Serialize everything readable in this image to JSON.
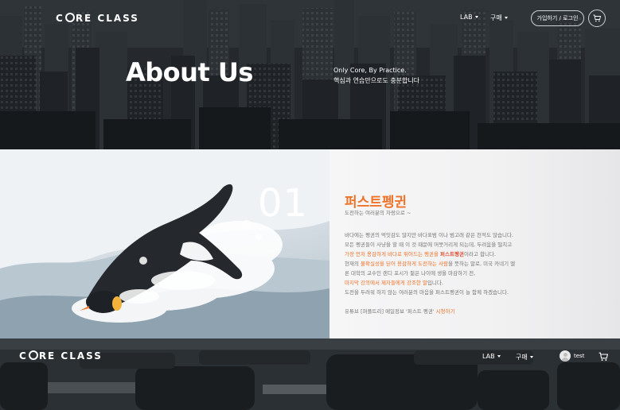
{
  "brand": {
    "logo_text_left": "C",
    "logo_text_right": "RE CLASS"
  },
  "nav": {
    "lab_label": "LAB",
    "buy_label": "구매",
    "auth_label": "가입하기 / 로그인",
    "user_label": "test"
  },
  "hero": {
    "title": "About Us",
    "subtitle_line1": "Only Core, By Practice.",
    "subtitle_line2": "핵심과 연습만으로도 충분합니다"
  },
  "feature": {
    "number": "01",
    "title": "퍼스트펭귄",
    "subtitle": "도전하는 여러분의 자랑으로 ~",
    "lines": [
      {
        "parts": [
          {
            "t": "바다에는 펭귄의 먹잇감도 많지만 바다표범 이나 범고래 같은 천적도 많습니다."
          }
        ]
      },
      {
        "parts": [
          {
            "t": "모든 펭귄들이 사냥을 할 때 이 것 때문에 머뭇거리게 되는데, 두려움을 떨치고"
          }
        ]
      },
      {
        "parts": [
          {
            "t": "가장 먼저 용감하게 바다로 뛰어드는 펭귄을 ",
            "c": "hl"
          },
          {
            "t": "퍼스트펭귄",
            "c": "hl2"
          },
          {
            "t": "이라고 합니다."
          }
        ]
      },
      {
        "parts": [
          {
            "t": "현재의 "
          },
          {
            "t": "불확실성을 딛어 용감하게 도전하는 사람",
            "c": "hl"
          },
          {
            "t": "을 뜻하는 말로, 미국 카네기 멜"
          }
        ]
      },
      {
        "parts": [
          {
            "t": "론 대학의 교수인 랜디 포시가 젊은 나이에 생을 마감하기 전,"
          }
        ]
      },
      {
        "parts": [
          {
            "t": "마지막 강의에서 제자들에게 강조한 말",
            "c": "hl"
          },
          {
            "t": "입니다."
          }
        ]
      },
      {
        "parts": [
          {
            "t": "도전을 두려워 하지 않는 여러분의 마음을 퍼스트펭귄이 늘 함께 하겠습니다."
          }
        ]
      },
      {
        "parts": [
          {
            "t": ""
          }
        ]
      },
      {
        "parts": [
          {
            "t": "유튜브 [퍼플트리] 메일정보 '퍼스트 펭귄' "
          },
          {
            "t": "시청하기",
            "c": "hl"
          }
        ]
      }
    ]
  },
  "colors": {
    "accent": "#f0732a",
    "text_gray": "#777777"
  },
  "icons": [
    "cart-icon",
    "caret-down-icon",
    "avatar-icon"
  ]
}
